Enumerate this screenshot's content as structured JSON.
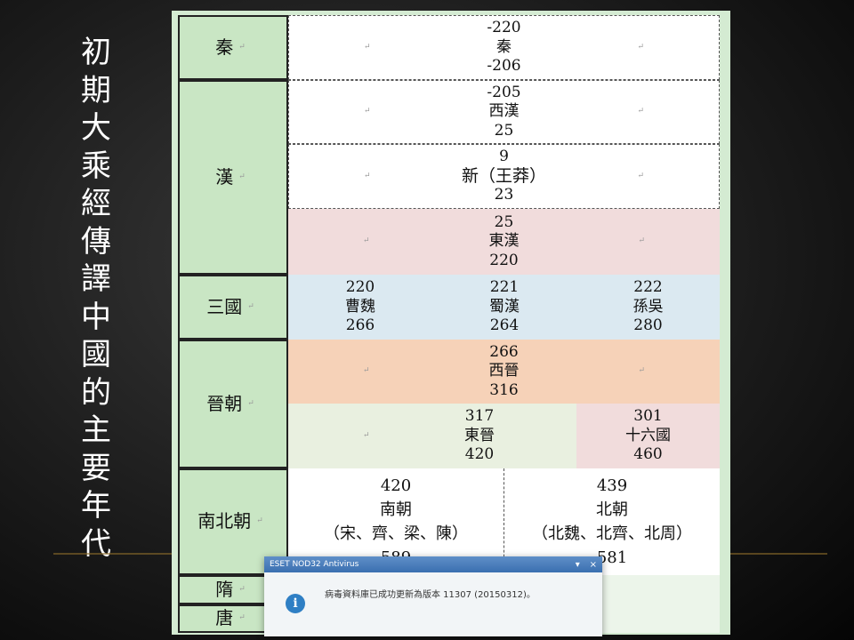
{
  "title": "初期大乘經傳譯中國的主要年代",
  "table": {
    "qin": {
      "label": "秦",
      "start": "-220",
      "name": "秦",
      "end": "-206"
    },
    "han": {
      "label": "漢",
      "west": {
        "start": "-205",
        "name": "西漢",
        "end": "25"
      },
      "xin": {
        "start": "9",
        "name": "新（王莽）",
        "end": "23"
      },
      "east": {
        "start": "25",
        "name": "東漢",
        "end": "220"
      }
    },
    "sanguo": {
      "label": "三國",
      "wei": {
        "start": "220",
        "name": "曹魏",
        "end": "266"
      },
      "shu": {
        "start": "221",
        "name": "蜀漢",
        "end": "264"
      },
      "wu": {
        "start": "222",
        "name": "孫吳",
        "end": "280"
      }
    },
    "jin": {
      "label": "晉朝",
      "west": {
        "start": "266",
        "name": "西晉",
        "end": "316"
      },
      "east": {
        "start": "317",
        "name": "東晉",
        "end": "420"
      },
      "sixteen": {
        "start": "301",
        "name": "十六國",
        "end": "460"
      }
    },
    "nanbei": {
      "label": "南北朝",
      "south": {
        "start": "420",
        "name": "南朝",
        "sub": "（宋、齊、梁、陳）",
        "end": "589"
      },
      "north": {
        "start": "439",
        "name": "北朝",
        "sub": "（北魏、北齊、北周）",
        "end": "581"
      }
    },
    "sui": {
      "label": "隋"
    },
    "tang": {
      "label": "唐"
    }
  },
  "popup": {
    "app_title": "ESET NOD32 Antivirus",
    "message": "病毒資料庫已成功更新為版本 11307 (20150312)。",
    "minimize": "▾",
    "close": "×"
  }
}
